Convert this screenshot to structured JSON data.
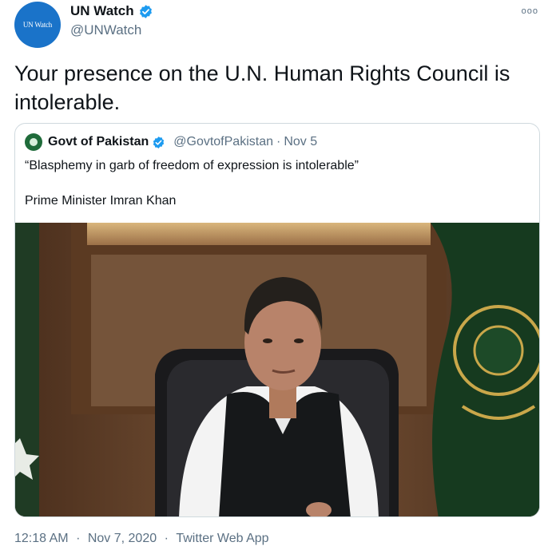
{
  "tweet": {
    "author_name": "UN Watch",
    "author_handle": "@UNWatch",
    "avatar_text": "UN Watch",
    "more_icon": "more-options-icon",
    "text": "Your presence on the U.N. Human Rights Council is intolerable.",
    "verified_icon": "verified-badge-icon"
  },
  "quote": {
    "author_name": "Govt of Pakistan",
    "author_handle": "@GovtofPakistan",
    "separator": "·",
    "date": "Nov 5",
    "text_line1": "“Blasphemy in garb of freedom of expression is intolerable”",
    "text_line2": "Prime Minister Imran Khan"
  },
  "footer": {
    "time": "12:18 AM",
    "separator": "·",
    "date": "Nov 7, 2020",
    "source": "Twitter Web App"
  },
  "colors": {
    "text_primary": "#0f1419",
    "text_secondary": "#5b7083",
    "verified_blue": "#1d9bf0",
    "border": "#cfd9de",
    "unwatch_blue": "#1a73c9",
    "pakistan_green": "#1f6b3a"
  }
}
